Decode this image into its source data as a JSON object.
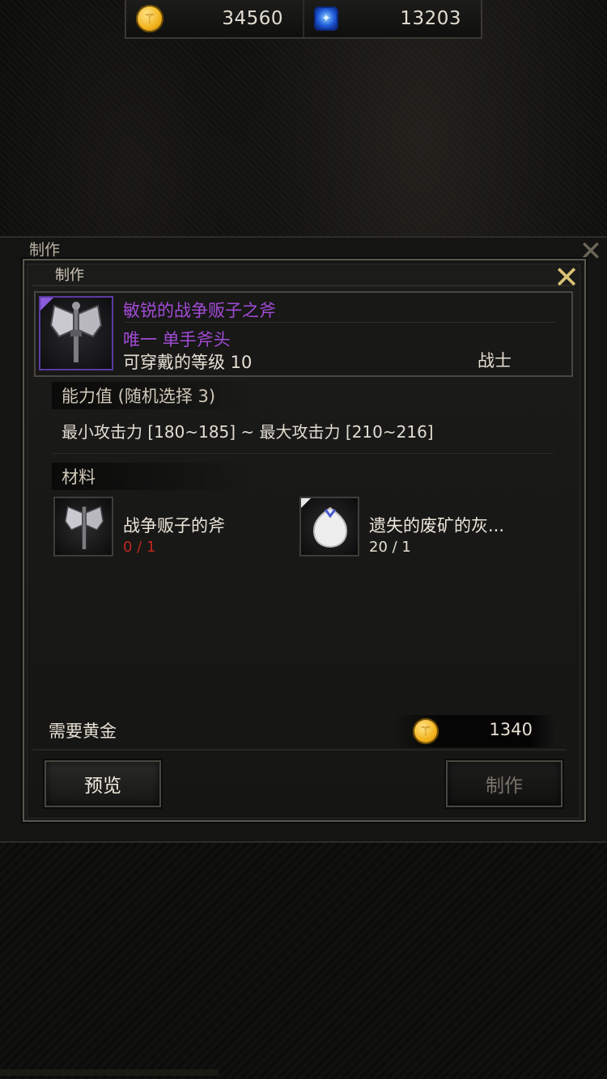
{
  "currency": {
    "gold": {
      "icon": "gold-coin-icon",
      "value": "34560"
    },
    "gem": {
      "icon": "blue-gem-icon",
      "value": "13203"
    }
  },
  "outer_window": {
    "title": "制作"
  },
  "panel": {
    "title": "制作",
    "item": {
      "name": "敏锐的战争贩子之斧",
      "type": "唯一 单手斧头",
      "level": "可穿戴的等级 10",
      "class": "战士",
      "icon": "battle-axe-icon",
      "rarity_color": "#a24bd6"
    },
    "stats": {
      "heading": "能力值 (随机选择 3)",
      "line": "最小攻击力 [180~185] ~ 最大攻击力 [210~216]"
    },
    "materials": {
      "heading": "材料",
      "items": [
        {
          "name": "战争贩子的斧",
          "count": "0 / 1",
          "icon": "battle-axe-icon",
          "count_color": "#c0281e"
        },
        {
          "name": "遗失的废矿的灰...",
          "count": "20 / 1",
          "icon": "white-ash-crystal-icon",
          "count_color": "#e6e0d4"
        }
      ]
    },
    "gold_required": {
      "label": "需要黄金",
      "value": "1340",
      "icon": "gold-coin-icon"
    },
    "buttons": {
      "preview": "预览",
      "craft": "制作"
    }
  }
}
